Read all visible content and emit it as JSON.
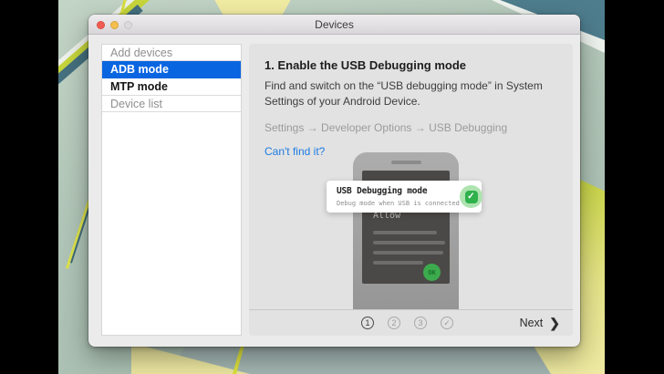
{
  "window": {
    "title": "Devices"
  },
  "sidebar": {
    "items": [
      {
        "label": "Add devices"
      },
      {
        "label": "ADB mode"
      },
      {
        "label": "MTP mode"
      },
      {
        "label": "Device list"
      }
    ]
  },
  "content": {
    "heading": "1. Enable the USB Debugging mode",
    "description": "Find and switch on the “USB debugging mode” in System Settings of your Android Device.",
    "breadcrumb": "Settings → Developer Options → USB Debugging",
    "link": "Can't find it?"
  },
  "illustration": {
    "tooltip_title": "USB Debugging mode",
    "tooltip_subtitle": "Debug mode when USB is connected",
    "check_glyph": "✓",
    "phone_dialog_title": "Allow",
    "ok_label": "OK"
  },
  "footer": {
    "steps": [
      {
        "label": "1",
        "active": true
      },
      {
        "label": "2",
        "active": false
      },
      {
        "label": "3",
        "active": false
      },
      {
        "label": "✓",
        "active": false
      }
    ],
    "next_label": "Next",
    "next_chevron": "❯"
  },
  "colors": {
    "selection_blue": "#0a65e1",
    "link_blue": "#1c7be1",
    "check_green": "#2fb14c",
    "check_green_light": "#aee3b0",
    "ok_green": "#3cab4d",
    "titlebar_red": "#f25d53",
    "titlebar_yellow": "#f5bf4f"
  }
}
